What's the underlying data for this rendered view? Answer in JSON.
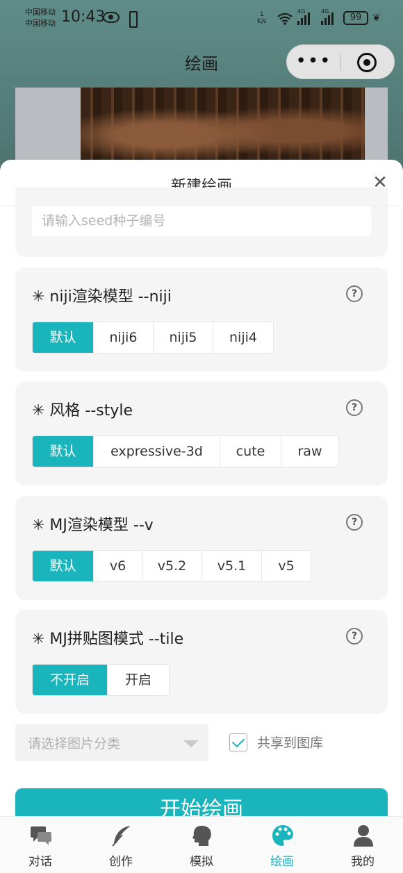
{
  "status": {
    "carrier1": "中国移动",
    "carrier2": "中国移动",
    "time": "10:43",
    "speed_value": "1",
    "speed_unit": "K/s",
    "network1": "4G",
    "network2": "4G",
    "battery": "99"
  },
  "nav": {
    "title": "绘画",
    "menu": "•••"
  },
  "sheet": {
    "title": "新建绘画",
    "seed_placeholder": "请输入seed种子编号"
  },
  "options": [
    {
      "title": "✳ niji渲染模型 --niji",
      "items": [
        "默认",
        "niji6",
        "niji5",
        "niji4"
      ]
    },
    {
      "title": "✳ 风格 --style",
      "items": [
        "默认",
        "expressive-3d",
        "cute",
        "raw"
      ]
    },
    {
      "title": "✳ MJ渲染模型 --v",
      "items": [
        "默认",
        "v6",
        "v5.2",
        "v5.1",
        "v5"
      ]
    },
    {
      "title": "✳ MJ拼贴图模式 --tile",
      "items": [
        "不开启",
        "开启"
      ]
    }
  ],
  "help_symbol": "?",
  "category": {
    "placeholder": "请选择图片分类"
  },
  "share": {
    "label": "共享到图库",
    "checked": true
  },
  "start_button": "开始绘画",
  "tabs": [
    {
      "label": "对话",
      "icon": "chat-icon"
    },
    {
      "label": "创作",
      "icon": "feather-icon"
    },
    {
      "label": "模拟",
      "icon": "head-icon"
    },
    {
      "label": "绘画",
      "icon": "palette-icon",
      "active": true
    },
    {
      "label": "我的",
      "icon": "user-icon"
    }
  ],
  "colors": {
    "accent": "#19b4bc"
  }
}
